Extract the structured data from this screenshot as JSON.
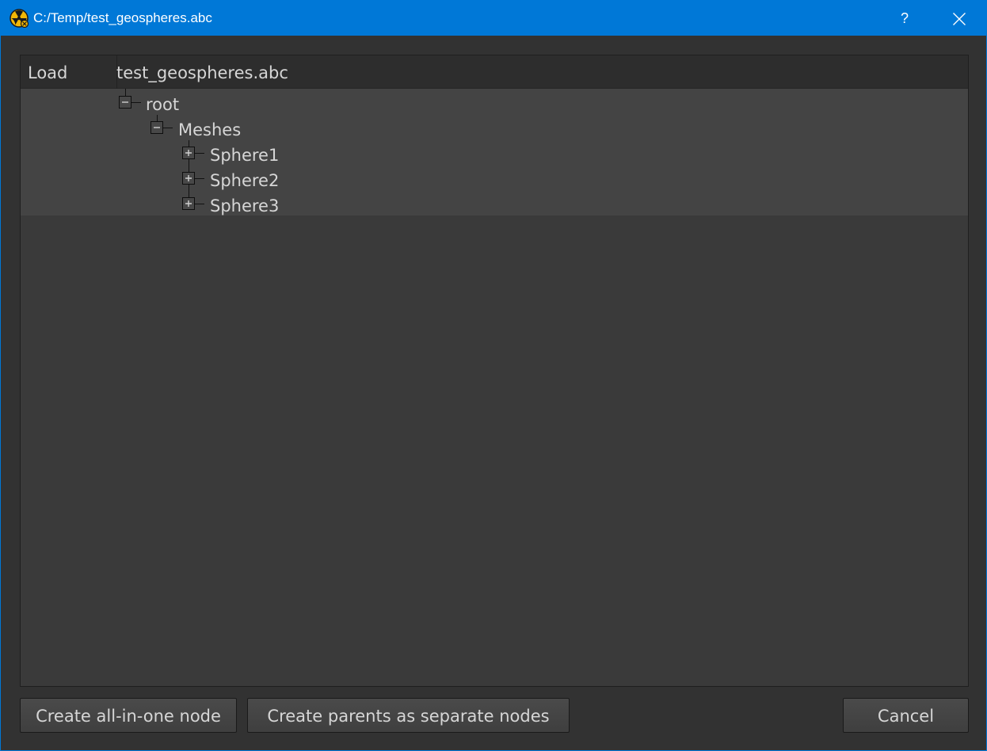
{
  "window": {
    "title": "C:/Temp/test_geospheres.abc",
    "help_label": "?"
  },
  "tree": {
    "columns": [
      "Load",
      "test_geospheres.abc"
    ],
    "nodes": [
      {
        "label": "root",
        "state": "expanded",
        "depth": 0
      },
      {
        "label": "Meshes",
        "state": "expanded",
        "depth": 1
      },
      {
        "label": "Sphere1",
        "state": "collapsed",
        "depth": 2
      },
      {
        "label": "Sphere2",
        "state": "collapsed",
        "depth": 2
      },
      {
        "label": "Sphere3",
        "state": "collapsed",
        "depth": 2
      }
    ]
  },
  "buttons": {
    "all_in_one": "Create all-in-one node",
    "parents_separate": "Create parents as separate nodes",
    "cancel": "Cancel"
  },
  "icons": {
    "app": "nuke-radiation-icon",
    "close": "close-icon",
    "expand": "plus-icon",
    "collapse": "minus-icon"
  },
  "colors": {
    "titlebar": "#0078d7",
    "background": "#323232",
    "tree_rows": "#444444",
    "text": "#d6d6d6"
  }
}
